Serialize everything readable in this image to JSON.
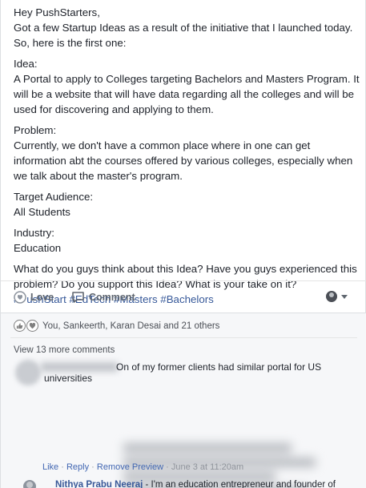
{
  "post": {
    "lines": [
      "Hey PushStarters,",
      "Got a few Startup Ideas as a result of the initiative that I launched today.",
      "So, here is the first one:",
      "Idea:",
      "A Portal to apply to Colleges targeting Bachelors and Masters Program. It",
      "will be a website that will have data regarding all the colleges and will be",
      "used for discovering and applying to them.",
      "Problem:",
      "Currently, we don't have a common place where in one can get",
      "information abt the courses offered by various colleges, especially when",
      "we talk about the master's program.",
      "Target Audience:",
      "All Students",
      "Industry:",
      "Education",
      "What do you guys think about this Idea? Have you guys experienced this",
      "problem? Do you support this Idea? What is your take on it?",
      "#PushStart #EdTech #Masters #Bachelors"
    ]
  },
  "actions": {
    "love_label": "Love",
    "comment_label": "Comment"
  },
  "reactions": {
    "summary": "You, Sankeerth, Karan Desai and 21 others"
  },
  "comments": {
    "view_more": "View 13 more comments",
    "first": {
      "text_line1": "On of my former clients had similar portal for US",
      "text_line2": "universities",
      "meta": {
        "like": "Like",
        "reply": "Reply",
        "remove_preview": "Remove Preview",
        "timestamp": "June 3 at 11:20am"
      }
    },
    "second": {
      "author": "Nithya Prabu Neeraj",
      "text": " - I'm an education entrepreneur and founder of"
    }
  },
  "colors": {
    "link": "#365899",
    "meta_link": "#4267b2",
    "muted": "#606770",
    "comments_bg": "#f6f7f9"
  }
}
